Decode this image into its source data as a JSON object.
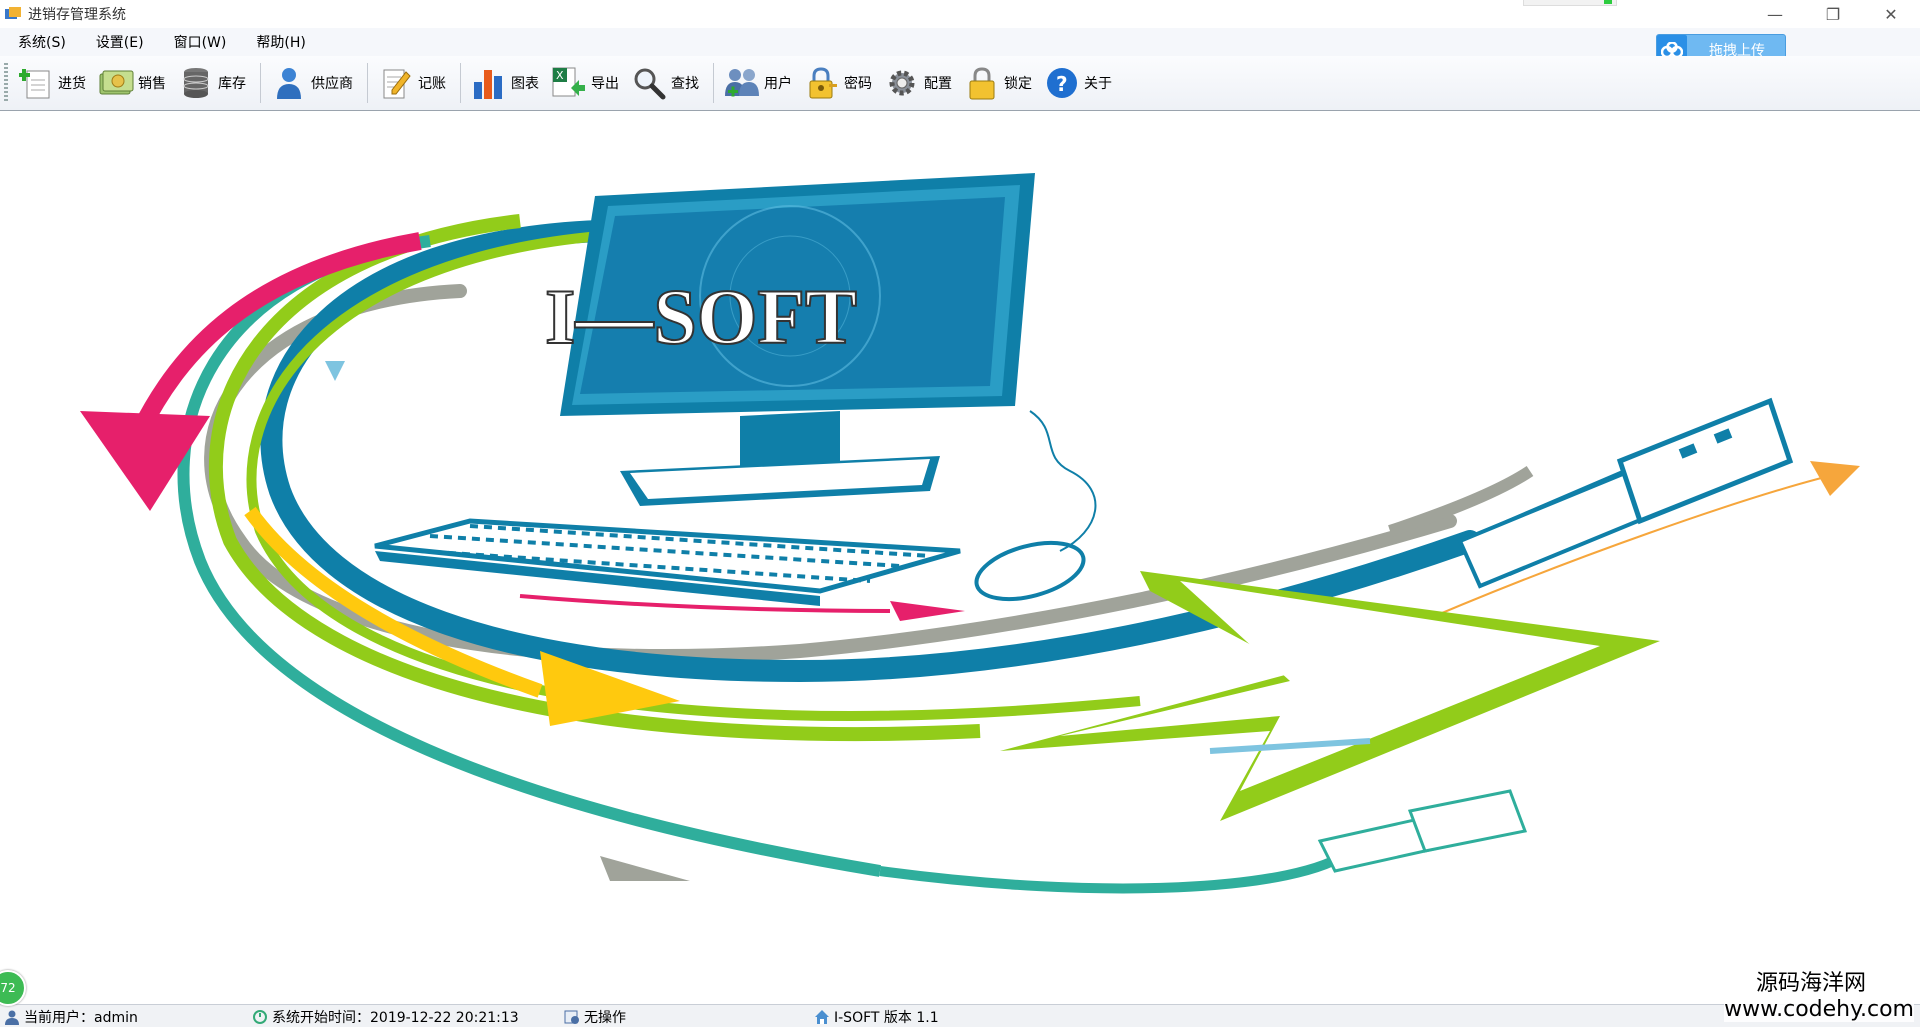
{
  "window": {
    "title": "进销存管理系统",
    "minimize_glyph": "—",
    "restore_glyph": "❐",
    "close_glyph": "✕"
  },
  "menu": [
    {
      "label": "系统(S)"
    },
    {
      "label": "设置(E)"
    },
    {
      "label": "窗口(W)"
    },
    {
      "label": "帮助(H)"
    }
  ],
  "upload": {
    "label": "拖拽上传",
    "icon": "cloud-icon"
  },
  "toolbar": [
    {
      "label": "进货",
      "icon": "add-document-icon"
    },
    {
      "label": "销售",
      "icon": "money-icon"
    },
    {
      "label": "库存",
      "icon": "database-icon"
    },
    {
      "label": "供应商",
      "icon": "person-icon"
    },
    {
      "label": "记账",
      "icon": "notepad-pencil-icon"
    },
    {
      "label": "图表",
      "icon": "bar-chart-icon"
    },
    {
      "label": "导出",
      "icon": "excel-export-icon"
    },
    {
      "label": "查找",
      "icon": "magnifier-icon"
    },
    {
      "label": "用户",
      "icon": "users-icon"
    },
    {
      "label": "密码",
      "icon": "key-lock-icon"
    },
    {
      "label": "配置",
      "icon": "gear-icon"
    },
    {
      "label": "锁定",
      "icon": "padlock-icon"
    },
    {
      "label": "关于",
      "icon": "help-icon"
    }
  ],
  "splash": {
    "brand": "I—SOFT"
  },
  "status": {
    "user": "当前用户：admin",
    "start_time": "系统开始时间：2019-12-22 20:21:13",
    "operation": "无操作",
    "version": "I-SOFT 版本 1.1"
  },
  "badge": "72",
  "watermark": {
    "name": "源码海洋网",
    "url": "www.codehy.com"
  },
  "colors": {
    "monitor_blue": "#0f7fa8",
    "magenta": "#e6206b",
    "lime": "#92cc1a",
    "teal": "#2fae9c",
    "yellow": "#ffc90e",
    "gray": "#a0a39a",
    "orange": "#f6a63c"
  }
}
